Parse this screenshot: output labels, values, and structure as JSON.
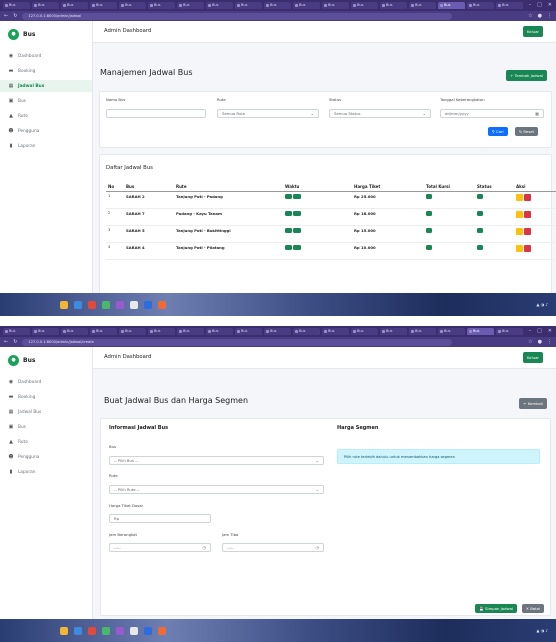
{
  "browser": {
    "tabs": [
      "Bus",
      "Bus",
      "Bus",
      "Bus",
      "Bus",
      "Bus",
      "Bus",
      "Bus",
      "Bus",
      "Bus",
      "Bus",
      "Bus",
      "Bus",
      "Bus",
      "Bus",
      "Bus",
      "Bus",
      "Bus"
    ],
    "url_list": "127.0.0.1:8000/admin/jadwal",
    "url_create": "127.0.0.1:8000/admin/jadwal/create"
  },
  "app": {
    "brand": "Bus",
    "sidebar": [
      "Dashboard",
      "Booking",
      "Jadwal Bus",
      "Bus",
      "Rute",
      "Pengguna",
      "Laporan"
    ],
    "topbar_title": "Admin Dashboard",
    "logout": "Keluar"
  },
  "list_page": {
    "title": "Manajemen Jadwal Bus",
    "add_button": "+ Tambah Jadwal",
    "filters": {
      "nama_bus_label": "Nama Bus",
      "rute_label": "Rute",
      "rute_value": "Semua Rute",
      "status_label": "Status",
      "status_value": "Semua Status",
      "tanggal_label": "Tanggal Keberangkatan",
      "tanggal_placeholder": "dd/mm/yyyy",
      "search_button": "Cari",
      "reset_button": "Reset"
    },
    "table_title": "Daftar Jadwal Bus",
    "columns": [
      "No",
      "Bus",
      "Rute",
      "Waktu",
      "Harga Tiket",
      "Total Kursi",
      "Status",
      "Aksi"
    ],
    "rows": [
      {
        "no": "1",
        "bus": "SARAH 2",
        "rute": "Tanjung Poti - Padang",
        "harga": "Rp 25.000"
      },
      {
        "no": "2",
        "bus": "SARAH 7",
        "rute": "Padang - Kayu Tanam",
        "harga": "Rp 18.000"
      },
      {
        "no": "3",
        "bus": "SARAH 5",
        "rute": "Tanjung Poti - Bukittinggi",
        "harga": "Rp 15.000"
      },
      {
        "no": "4",
        "bus": "SARAH 4",
        "rute": "Tanjung Poti - Pilatang",
        "harga": "Rp 10.000"
      }
    ]
  },
  "create_page": {
    "title": "Buat Jadwal Bus dan Harga Segmen",
    "back_button": "Kembali",
    "info_title": "Informasi Jadwal Bus",
    "bus_label": "Bus",
    "bus_value": "-- Pilih Bus --",
    "rute_label": "Rute",
    "rute_value": "-- Pilih Rute --",
    "harga_label": "Harga Tiket Dasar",
    "harga_prefix": "Rp",
    "jam_berangkat_label": "Jam Berangkat",
    "jam_tiba_label": "Jam Tiba",
    "time_placeholder": "--:--",
    "segment_title": "Harga Segmen",
    "segment_info": "Pilih rute terlebih dahulu untuk menambahkan harga segmen",
    "save_button": "Simpan Jadwal",
    "reset_button": "Batal"
  }
}
